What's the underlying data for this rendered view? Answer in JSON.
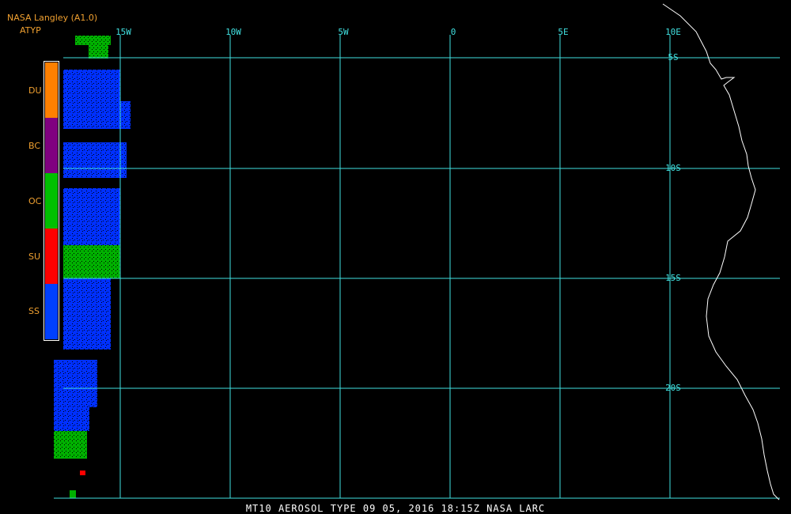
{
  "header": {
    "source": "NASA Langley (A1.0)",
    "product": "ATYP"
  },
  "legend": [
    {
      "code": "DU",
      "color": "#ff8000"
    },
    {
      "code": "BC",
      "color": "#800080"
    },
    {
      "code": "OC",
      "color": "#00c000"
    },
    {
      "code": "SU",
      "color": "#ff0000"
    },
    {
      "code": "SS",
      "color": "#0040ff"
    }
  ],
  "longitude_labels": [
    "15W",
    "10W",
    "5W",
    "0",
    "5E",
    "10E"
  ],
  "latitude_labels": [
    "5S",
    "10S",
    "15S",
    "20S"
  ],
  "footer": {
    "caption": "MT10  AEROSOL TYPE   09 05, 2016 18:15Z   NASA LARC"
  },
  "colors": {
    "grid": "#40e0e0",
    "coastline": "#ffffff",
    "background": "#000000",
    "label": "#f0a030"
  }
}
